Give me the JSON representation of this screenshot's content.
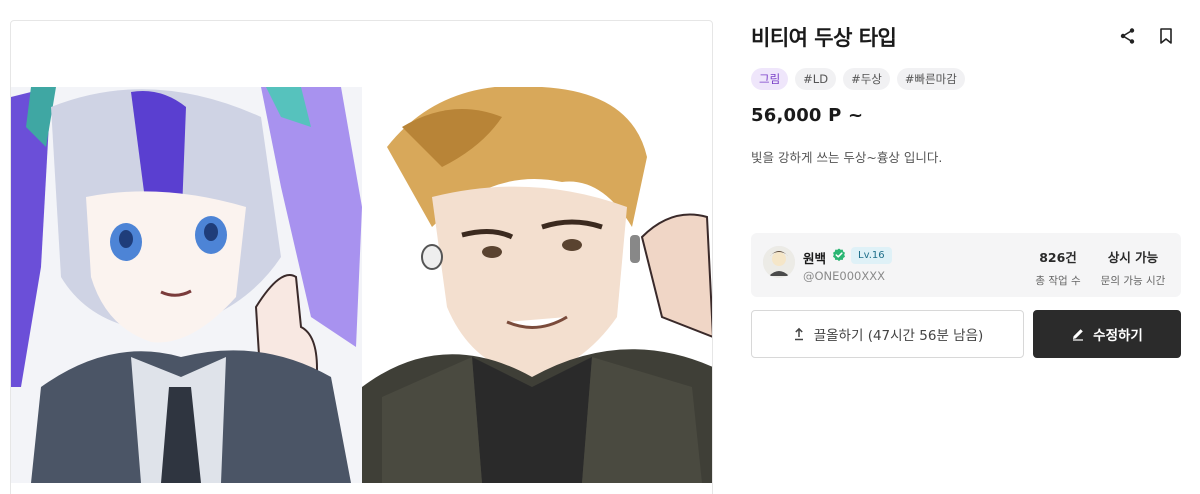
{
  "product": {
    "title": "비티여 두상 타입",
    "tags": [
      {
        "label": "그림",
        "kind": "category"
      },
      {
        "label": "#LD",
        "kind": "hashtag"
      },
      {
        "label": "#두상",
        "kind": "hashtag"
      },
      {
        "label": "#빠른마감",
        "kind": "hashtag"
      }
    ],
    "price": "56,000 P ~",
    "description": "빛을 강하게 쓰는 두상~흉상 입니다."
  },
  "actions": {
    "share_icon": "share-icon",
    "bookmark_icon": "bookmark-icon",
    "bump_label": "끌올하기 (47시간 56분 남음)",
    "bump_icon": "upload-arrow-icon",
    "edit_label": "수정하기",
    "edit_icon": "pencil-icon"
  },
  "artist": {
    "name": "원백",
    "verified_icon": "verified-check-icon",
    "level": "Lv.16",
    "handle": "@ONE000XXX",
    "stats": [
      {
        "value": "826건",
        "label": "총 작업 수"
      },
      {
        "value": "상시 가능",
        "label": "문의 가능 시간"
      }
    ]
  },
  "gallery": {
    "images": [
      "illustration-girl-twintails",
      "illustration-man-blonde-jacket"
    ]
  },
  "colors": {
    "category_tag_text": "#7a3fc8",
    "category_tag_bg": "#efe6fb",
    "level_badge_bg": "#dff1f7",
    "verified_green": "#2bb673",
    "primary_button": "#2b2b2b"
  }
}
